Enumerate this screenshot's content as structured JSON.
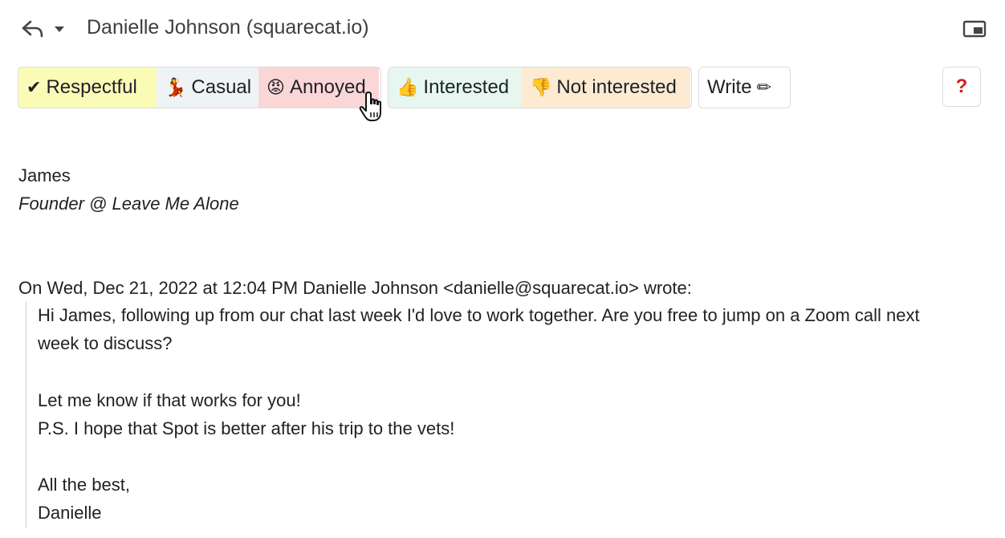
{
  "header": {
    "recipient": "Danielle Johnson (squarecat.io)",
    "reply_icon": "reply-icon",
    "dropdown_icon": "caret-down-icon",
    "popout_icon": "picture-in-picture-icon"
  },
  "toolbar": {
    "tone_chips": [
      {
        "emoji": "✔",
        "label": "Respectful",
        "color": "#fbfbb8"
      },
      {
        "emoji": "💃",
        "label": "Casual",
        "color": "#eef3f6"
      },
      {
        "emoji": "😡",
        "label": "Annoyed",
        "color": "#fbd6d6"
      }
    ],
    "response_chips": [
      {
        "emoji": "👍",
        "label": "Interested",
        "color": "#e6f7ef"
      },
      {
        "emoji": "👎",
        "label": "Not interested",
        "color": "#fcebd2"
      }
    ],
    "write": {
      "label": "Write",
      "emoji": "✏"
    },
    "help": {
      "label": "?"
    }
  },
  "signature": {
    "name": "James",
    "title": "Founder @ Leave Me Alone"
  },
  "quoted": {
    "attribution": "On Wed, Dec 21, 2022 at 12:04 PM Danielle Johnson <danielle@squarecat.io> wrote:",
    "lines": [
      "Hi James, following up from our chat last week I'd love to work together. Are you free to jump on a Zoom call next",
      "week to discuss?",
      "",
      "Let me know if that works for you!",
      "P.S. I hope that Spot is better after his trip to the vets!",
      "",
      "All the best,",
      "Danielle"
    ]
  }
}
